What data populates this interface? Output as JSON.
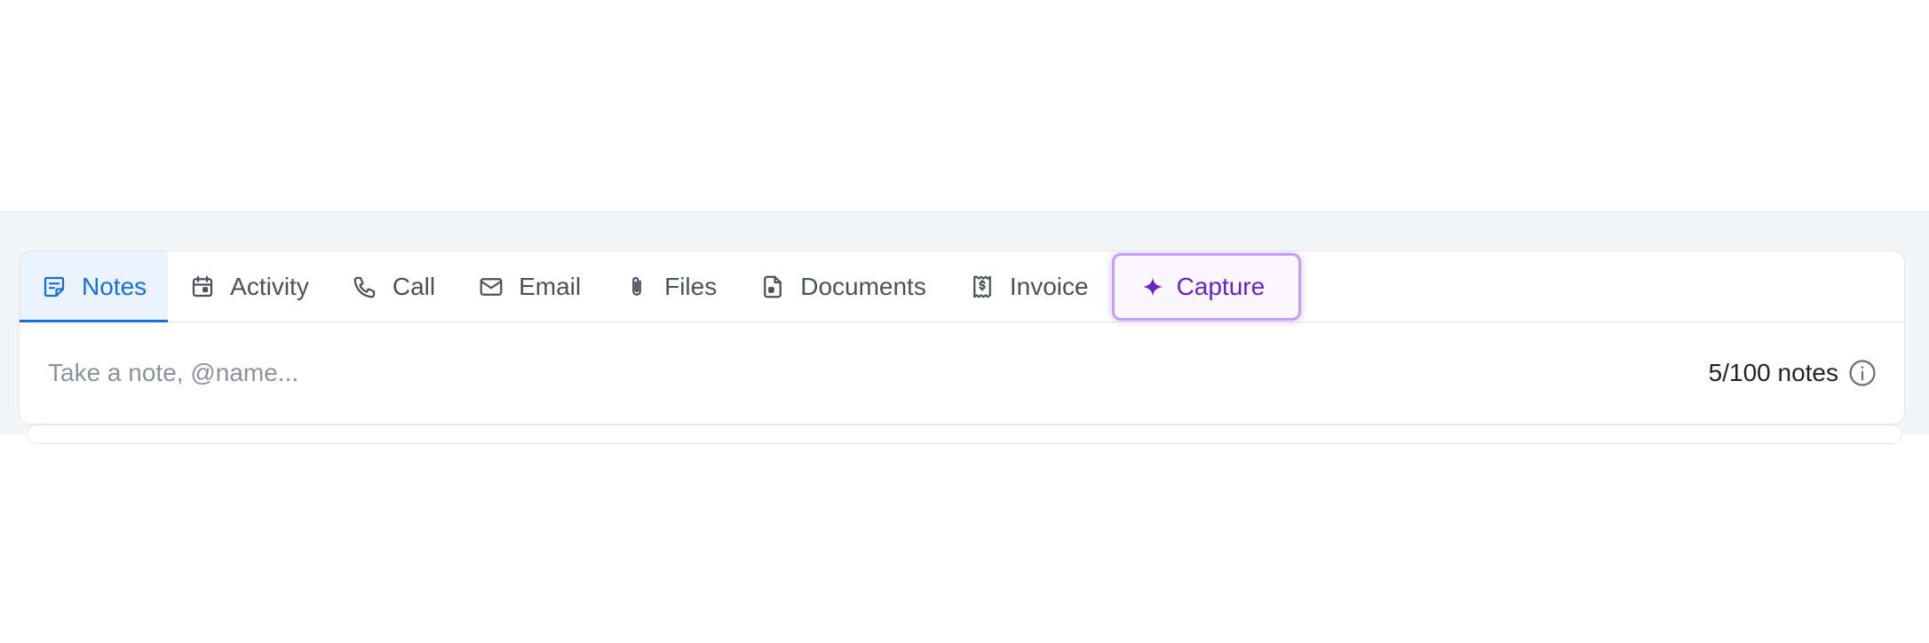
{
  "tabs": [
    {
      "id": "notes",
      "label": "Notes",
      "icon": "sticky-note-icon",
      "active": true
    },
    {
      "id": "activity",
      "label": "Activity",
      "icon": "calendar-icon",
      "active": false
    },
    {
      "id": "call",
      "label": "Call",
      "icon": "phone-icon",
      "active": false
    },
    {
      "id": "email",
      "label": "Email",
      "icon": "mail-icon",
      "active": false
    },
    {
      "id": "files",
      "label": "Files",
      "icon": "paperclip-icon",
      "active": false
    },
    {
      "id": "documents",
      "label": "Documents",
      "icon": "document-icon",
      "active": false
    },
    {
      "id": "invoice",
      "label": "Invoice",
      "icon": "receipt-icon",
      "active": false
    },
    {
      "id": "capture",
      "label": "Capture",
      "icon": "sparkle-icon",
      "active": false
    }
  ],
  "composer": {
    "placeholder": "Take a note, @name...",
    "value": ""
  },
  "counter": {
    "text": "5/100 notes",
    "icon": "info-icon"
  },
  "colors": {
    "active_tab": "#1a6ed8",
    "active_tab_bg": "#eaf2fd",
    "capture": "#6a22c6",
    "capture_border": "#c69cf6",
    "muted_text": "#4b515b",
    "placeholder": "#8c929b"
  }
}
